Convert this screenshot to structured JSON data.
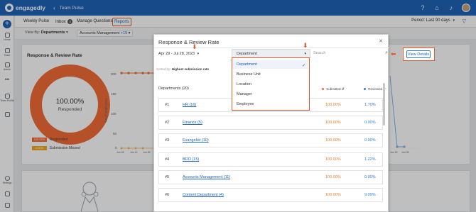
{
  "topbar": {
    "brand": "engagedly",
    "back_icon": "chevron-left-icon",
    "title": "Team Pulse",
    "icons": [
      "help-icon",
      "gift-icon",
      "bell-icon"
    ],
    "colors": {
      "primary": "#1f63b6",
      "accent": "#e25a2b"
    }
  },
  "sidebar": {
    "items": [
      {
        "label": "Home",
        "icon": "home-icon"
      },
      {
        "label": "Team",
        "icon": "team-icon"
      },
      {
        "label": "Admin",
        "icon": "admin-icon"
      },
      {
        "label": "",
        "icon": "more-icon"
      },
      {
        "label": "Team Profile",
        "icon": "team-profile-icon"
      },
      {
        "label": "",
        "icon": "list-icon"
      },
      {
        "label": "Settings",
        "icon": "gear-icon"
      }
    ]
  },
  "subnav": {
    "tabs": [
      {
        "label": "Weekly Pulse"
      },
      {
        "label": "Inbox",
        "badge": "0"
      },
      {
        "label": "Manage Questions"
      },
      {
        "label": "Reports",
        "active": true
      }
    ],
    "period": "Period: Last 90 days"
  },
  "filters": {
    "view_by_label": "View By:",
    "view_by_value": "Departments",
    "account": "Accounts Management",
    "account_more": "+19"
  },
  "card": {
    "title": "Response & Review Rate",
    "donut_pct": "100.00%",
    "donut_label": "Responded",
    "legend": [
      {
        "value": "100.00%",
        "label": "Responded",
        "color": "#f26b36"
      },
      {
        "value": "0.00%",
        "label": "Submission Missed",
        "color": "#f5a623"
      }
    ]
  },
  "chart_data": {
    "type": "line",
    "ylabel": "No.of employees",
    "yticks": [
      "200",
      "150",
      "100",
      "50",
      "0"
    ],
    "xticks_left": [
      "Jun 28",
      "Jun 12",
      "Jun 26"
    ],
    "xticks_right": [
      "Jun 16",
      "Jun 28"
    ]
  },
  "modal": {
    "title": "Response & Review Rate",
    "date_range": "Apr 29 - Jul 28, 2023",
    "dropdown_value": "Department",
    "search_placeholder": "Search",
    "sorted_by_label": "Sorted by:",
    "sorted_by_value": "Highest submission rate",
    "departments_header": "Departments (20)",
    "col_submitted": "Submitted",
    "col_reviewed": "Reviewed",
    "rows": [
      {
        "rank": "#1",
        "name": "HR (16)",
        "submitted": "100.00%",
        "reviewed": "1.70%"
      },
      {
        "rank": "#2",
        "name": "Finance (5)",
        "submitted": "100.00%",
        "reviewed": "0.00%"
      },
      {
        "rank": "#3",
        "name": "Evangelist (10)",
        "submitted": "100.00%",
        "reviewed": "0.00%"
      },
      {
        "rank": "#4",
        "name": "BDO (15)",
        "submitted": "100.00%",
        "reviewed": "1.22%"
      },
      {
        "rank": "#5",
        "name": "Accounts Management (11)",
        "submitted": "100.00%",
        "reviewed": "0.00%"
      },
      {
        "rank": "#6",
        "name": "Content Department (4)",
        "submitted": "100.00%",
        "reviewed": "9.09%"
      }
    ]
  },
  "menu": {
    "options": [
      {
        "label": "Department",
        "selected": true
      },
      {
        "label": "Business Unit"
      },
      {
        "label": "Location"
      },
      {
        "label": "Manager"
      },
      {
        "label": "Employee"
      }
    ]
  },
  "view_details": "View Details"
}
